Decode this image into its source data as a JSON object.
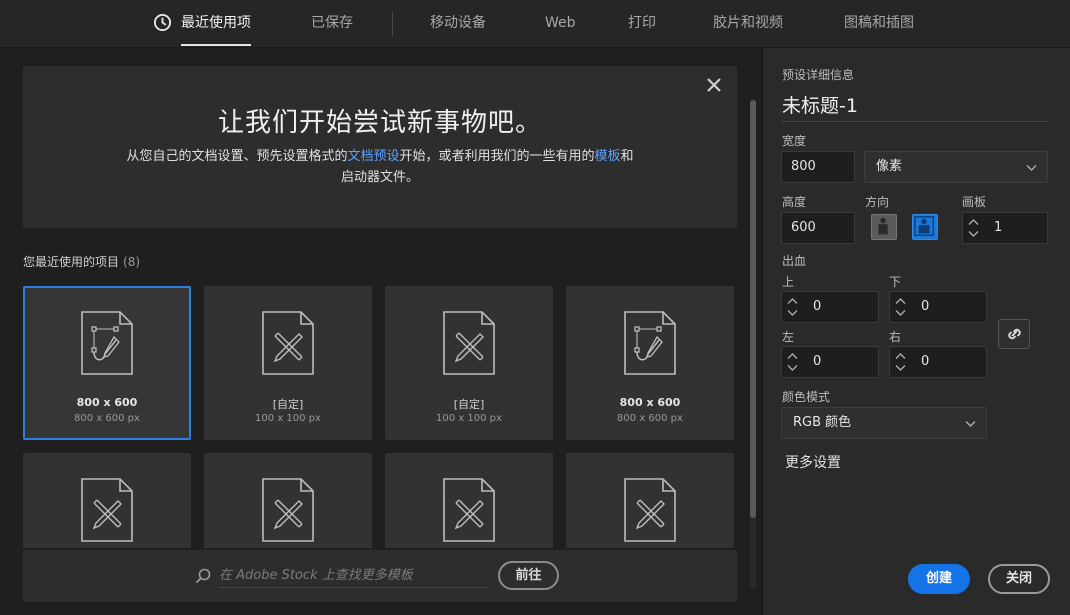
{
  "tabs": [
    {
      "label": "最近使用项",
      "active": true
    },
    {
      "label": "已保存"
    },
    {
      "label": "移动设备"
    },
    {
      "label": "Web"
    },
    {
      "label": "打印"
    },
    {
      "label": "胶片和视频"
    },
    {
      "label": "图稿和插图"
    }
  ],
  "hero": {
    "title": "让我们开始尝试新事物吧。",
    "text_1": "从您自己的文档设置、预先设置格式的",
    "link_1": "文档预设",
    "text_2": "开始，或者利用我们的一些有用的",
    "link_2": "模板",
    "text_3": "和启动器文件。"
  },
  "recent": {
    "label": "您最近使用的项目",
    "count": "(8)",
    "items": [
      {
        "name": "800 x 600",
        "size": "800 x 600 px",
        "icon": "artboard-doc-icon"
      },
      {
        "name": "[自定]",
        "size": "100 x 100 px",
        "icon": "blank-doc-icon"
      },
      {
        "name": "[自定]",
        "size": "100 x 100 px",
        "icon": "blank-doc-icon"
      },
      {
        "name": "800 x 600",
        "size": "800 x 600 px",
        "icon": "artboard-doc-icon"
      }
    ]
  },
  "stock": {
    "placeholder": "在 Adobe Stock 上查找更多模板",
    "go_label": "前往"
  },
  "panel": {
    "header": "预设详细信息",
    "doc_name": "未标题-1",
    "width_label": "宽度",
    "width_value": "800",
    "unit": "像素",
    "height_label": "高度",
    "height_value": "600",
    "orientation_label": "方向",
    "artboards_label": "画板",
    "artboards_value": "1",
    "bleed_label": "出血",
    "top_label": "上",
    "top_value": "0",
    "bottom_label": "下",
    "bottom_value": "0",
    "left_label": "左",
    "left_value": "0",
    "right_label": "右",
    "right_value": "0",
    "color_mode_label": "颜色模式",
    "color_mode": "RGB 颜色",
    "more_settings": "更多设置",
    "create_label": "创建",
    "close_label": "关闭"
  },
  "colors": {
    "accent": "#1473e6",
    "link": "#5da2ff",
    "selected_border": "#2b7fe2"
  }
}
